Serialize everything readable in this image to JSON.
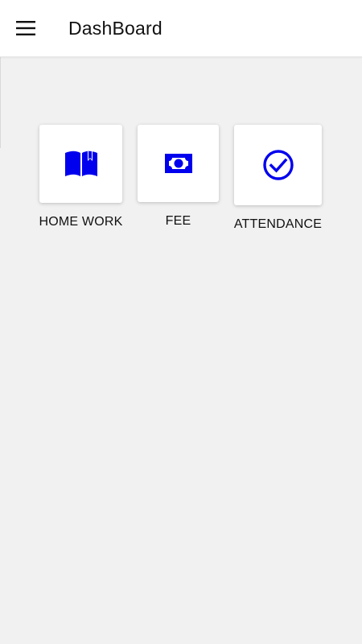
{
  "app_bar": {
    "title": "DashBoard",
    "menu_icon": "hamburger-menu-icon"
  },
  "colors": {
    "accent": "#0000ee",
    "background": "#f1f1f1",
    "card": "#ffffff"
  },
  "tiles": [
    {
      "label": "HOME WORK",
      "icon": "book-open-icon"
    },
    {
      "label": "FEE",
      "icon": "money-icon"
    },
    {
      "label": "ATTENDANCE",
      "icon": "check-circle-icon"
    }
  ]
}
